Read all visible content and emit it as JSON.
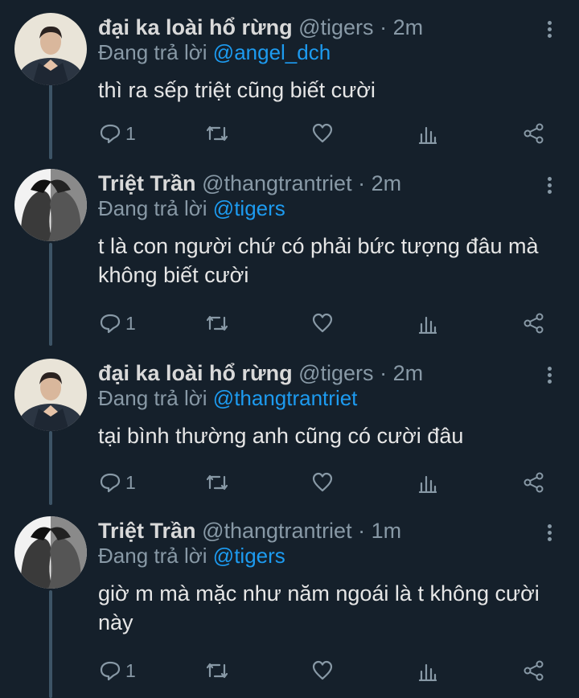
{
  "reply_prefix": "Đang trả lời",
  "tweets": [
    {
      "name": "đại ka loài hổ rừng",
      "handle": "@tigers",
      "time": "2m",
      "reply_to": "@angel_dch",
      "text": "thì ra sếp triệt cũng biết cười",
      "reply_count": "1",
      "avatar": "avatar-tigers"
    },
    {
      "name": "Triệt Trần",
      "handle": "@thangtrantriet",
      "time": "2m",
      "reply_to": "@tigers",
      "text": "t là con người chứ có phải bức tượng đâu mà không biết cười",
      "reply_count": "1",
      "avatar": "avatar-thangtrantriet"
    },
    {
      "name": "đại ka loài hổ rừng",
      "handle": "@tigers",
      "time": "2m",
      "reply_to": "@thangtrantriet",
      "text": "tại bình thường anh cũng có cười đâu",
      "reply_count": "1",
      "avatar": "avatar-tigers"
    },
    {
      "name": "Triệt Trần",
      "handle": "@thangtrantriet",
      "time": "1m",
      "reply_to": "@tigers",
      "text": "giờ m mà mặc như năm ngoái là t không cười này",
      "reply_count": "1",
      "avatar": "avatar-thangtrantriet"
    }
  ],
  "colors": {
    "background": "#15202b",
    "secondary_text": "#8899a6",
    "mention": "#1d9bf0",
    "thread_line": "#3d5466"
  }
}
